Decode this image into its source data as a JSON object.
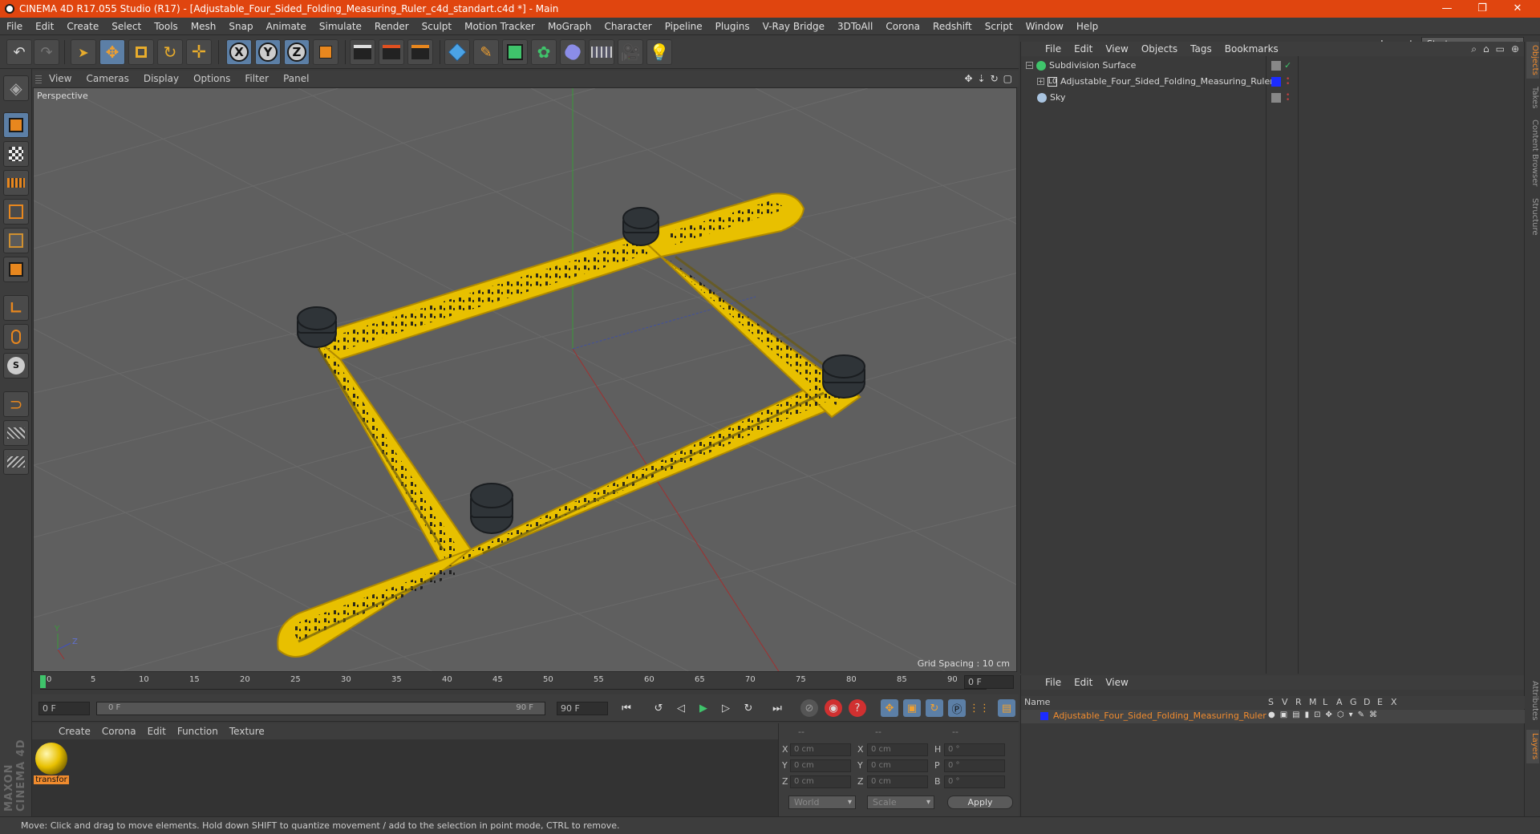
{
  "window": {
    "title": "CINEMA 4D R17.055 Studio (R17) - [Adjustable_Four_Sided_Folding_Measuring_Ruler_c4d_standart.c4d *] - Main",
    "controls": [
      "—",
      "❐",
      "✕"
    ]
  },
  "menubar": [
    "File",
    "Edit",
    "Create",
    "Select",
    "Tools",
    "Mesh",
    "Snap",
    "Animate",
    "Simulate",
    "Render",
    "Sculpt",
    "Motion Tracker",
    "MoGraph",
    "Character",
    "Pipeline",
    "Plugins",
    "V-Ray Bridge",
    "3DToAll",
    "Corona",
    "Redshift",
    "Script",
    "Window",
    "Help"
  ],
  "layout": {
    "label": "Layout:",
    "value": "Startup"
  },
  "toolbar": {
    "axis_labels": [
      "X",
      "Y",
      "Z"
    ]
  },
  "viewport": {
    "menu": [
      "View",
      "Cameras",
      "Display",
      "Options",
      "Filter",
      "Panel"
    ],
    "label": "Perspective",
    "grid_spacing": "Grid Spacing : 10 cm",
    "axis_labels": [
      "Y",
      "Z"
    ]
  },
  "timeline": {
    "ticks": [
      "0",
      "5",
      "10",
      "15",
      "20",
      "25",
      "30",
      "35",
      "40",
      "45",
      "50",
      "55",
      "60",
      "65",
      "70",
      "75",
      "80",
      "85",
      "90"
    ],
    "current_frame": "0 F"
  },
  "transport": {
    "start_field": "0 F",
    "slider_start": "0 F",
    "slider_end": "90 F",
    "end_field": "90 F"
  },
  "material_manager": {
    "menu": [
      "Create",
      "Corona",
      "Edit",
      "Function",
      "Texture"
    ],
    "material_name": "transfor"
  },
  "coordinates": {
    "headers": [
      "--",
      "--",
      "--"
    ],
    "rows": [
      {
        "a": "X",
        "av": "0 cm",
        "b": "X",
        "bv": "0 cm",
        "c": "H",
        "cv": "0 °"
      },
      {
        "a": "Y",
        "av": "0 cm",
        "b": "Y",
        "bv": "0 cm",
        "c": "P",
        "cv": "0 °"
      },
      {
        "a": "Z",
        "av": "0 cm",
        "b": "Z",
        "bv": "0 cm",
        "c": "B",
        "cv": "0 °"
      }
    ],
    "space": "World",
    "mode": "Scale",
    "apply": "Apply"
  },
  "object_manager": {
    "menu": [
      "File",
      "Edit",
      "View",
      "Objects",
      "Tags",
      "Bookmarks"
    ],
    "objects": [
      {
        "name": "Subdivision Surface"
      },
      {
        "name": "Adjustable_Four_Sided_Folding_Measuring_Ruler"
      },
      {
        "name": "Sky"
      }
    ]
  },
  "side_tabs": [
    "Objects",
    "Takes",
    "Content Browser",
    "Structure"
  ],
  "side_tabs_bottom": [
    "Attributes",
    "Layers"
  ],
  "layer_manager": {
    "menu": [
      "File",
      "Edit",
      "View"
    ],
    "columns": [
      "Name",
      "S",
      "V",
      "R",
      "M",
      "L",
      "A",
      "G",
      "D",
      "E",
      "X"
    ],
    "layer_name": "Adjustable_Four_Sided_Folding_Measuring_Ruler"
  },
  "brand": {
    "logo_text": "MAXON CINEMA 4D"
  },
  "status": "Move: Click and drag to move elements. Hold down SHIFT to quantize movement / add to the selection in point mode, CTRL to remove.",
  "colors": {
    "accent": "#e0450f",
    "ruler": "#e8c000",
    "selection": "#5c7fa6",
    "highlight": "#f08b2e"
  }
}
